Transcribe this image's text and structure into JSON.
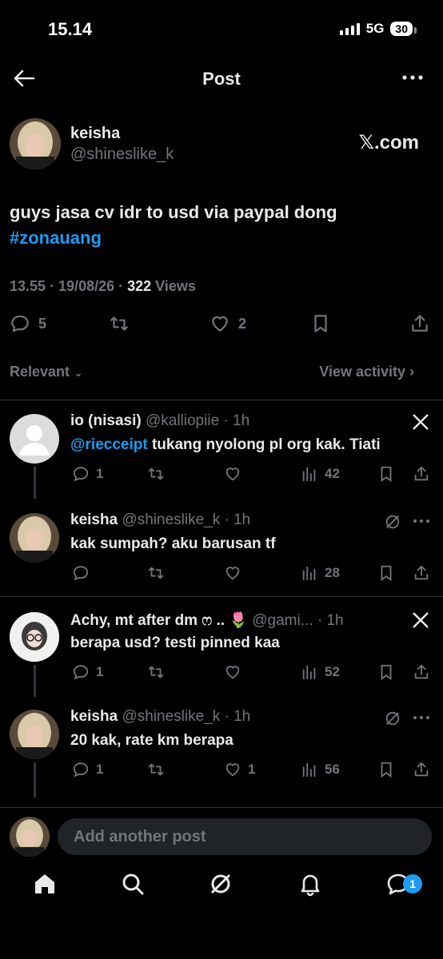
{
  "status_bar": {
    "time": "15.14",
    "network": "5G",
    "battery": "30"
  },
  "header": {
    "title": "Post"
  },
  "post": {
    "author_name": "keisha",
    "author_handle": "@shineslike_k",
    "source": "𝕏.com",
    "text": "guys jasa cv idr to usd via paypal dong",
    "hashtag": "#zonauang",
    "time": "13.55 · 19/08/26 · ",
    "views_count": "322",
    "views_label": " Views",
    "replies": "5",
    "likes": "2"
  },
  "sort": {
    "label": "Relevant",
    "view_activity": "View activity ›"
  },
  "replies": [
    {
      "name": "io (nisasi)",
      "handle": "@kalliopiie · 1h",
      "mention": "@riecceipt",
      "text": " tukang nyolong pl org kak. Tiati",
      "replies": "1",
      "likes": "",
      "views": "42"
    },
    {
      "name": "keisha",
      "handle": "@shineslike_k · 1h",
      "mention": "",
      "text": "kak sumpah? aku barusan tf",
      "replies": "",
      "likes": "",
      "views": "28"
    },
    {
      "name": "Achy, mt after dm ෆ .. 🌷",
      "handle": "@gami... · 1h",
      "mention": "",
      "text": "berapa usd? testi pinned kaa",
      "replies": "1",
      "likes": "",
      "views": "52"
    },
    {
      "name": "keisha",
      "handle": "@shineslike_k · 1h",
      "mention": "",
      "text": "20 kak, rate km berapa",
      "replies": "1",
      "likes": "1",
      "views": "56"
    }
  ],
  "compose": {
    "placeholder": "Add another post"
  },
  "nav": {
    "messages_badge": "1"
  },
  "colors": {
    "accent": "#1d9bf0",
    "muted": "#71767b",
    "background": "#000000"
  }
}
